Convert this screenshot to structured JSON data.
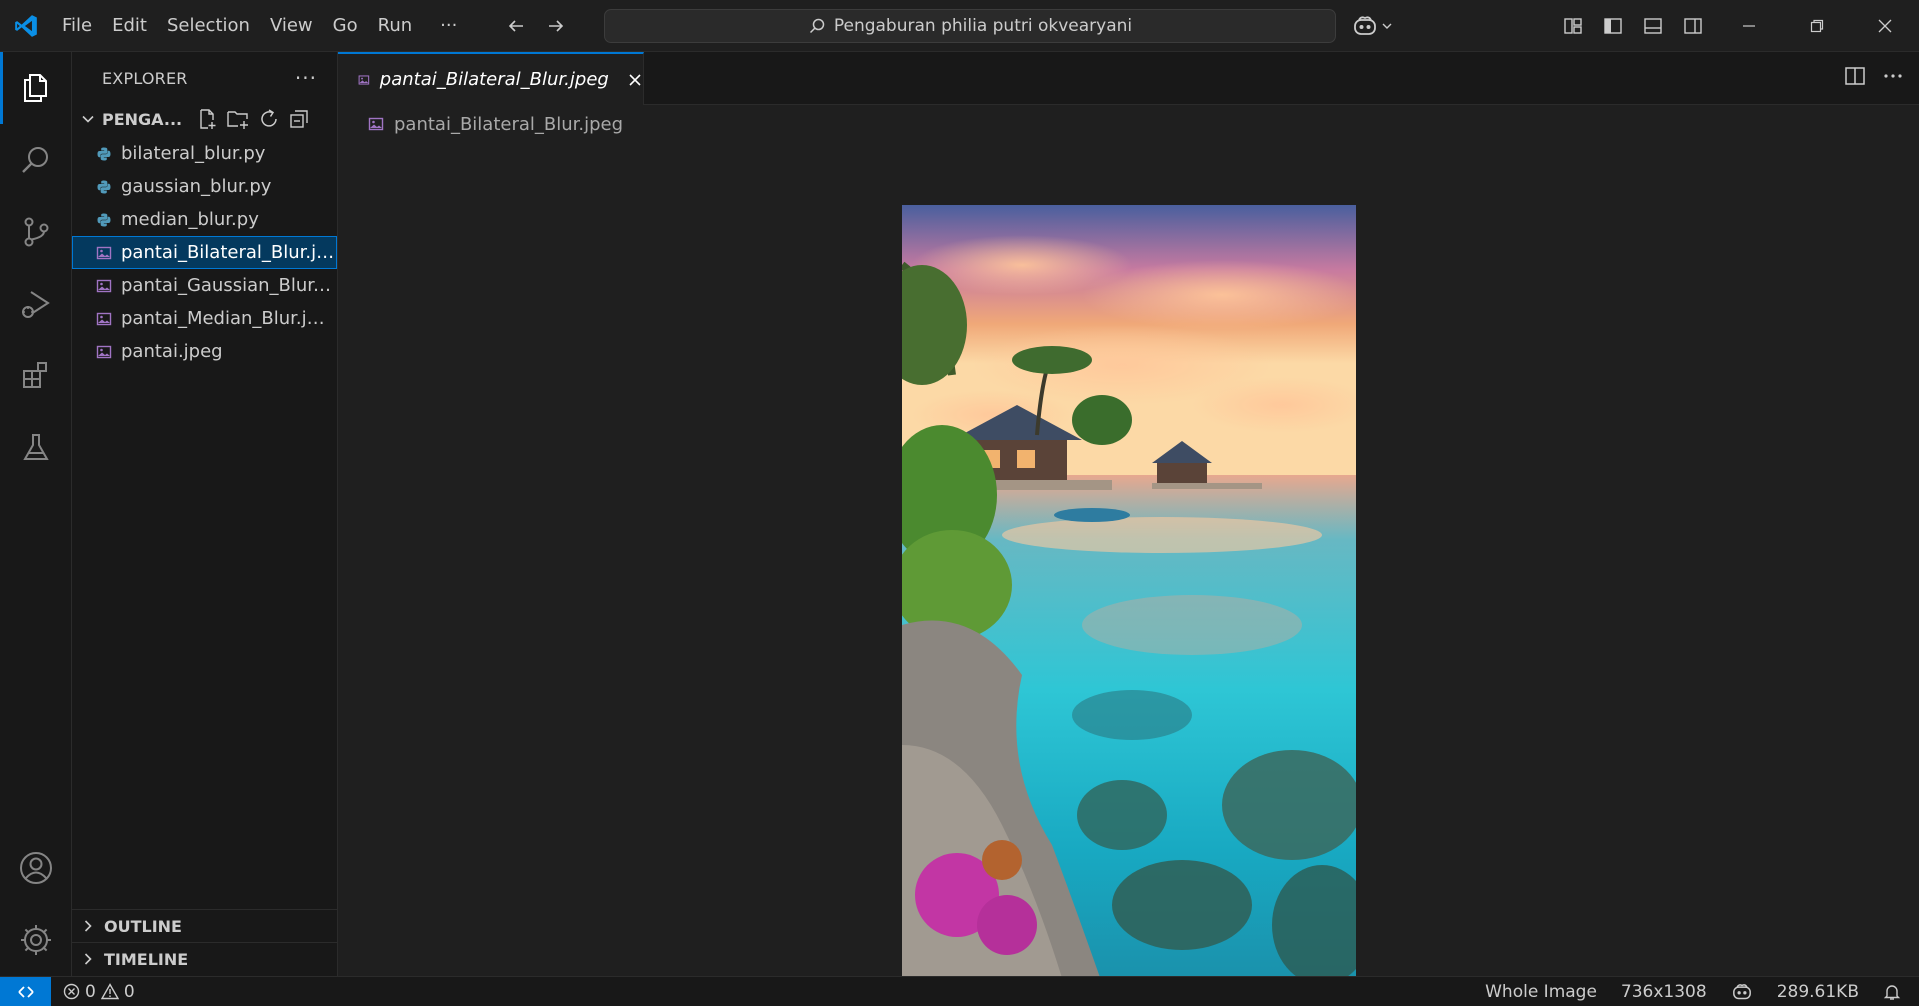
{
  "titlebar": {
    "menu": [
      "File",
      "Edit",
      "Selection",
      "View",
      "Go",
      "Run"
    ],
    "more_label": "···",
    "search_text": "Pengaburan philia putri okvearyani"
  },
  "explorer": {
    "title": "EXPLORER",
    "more_label": "···",
    "folder_name": "PENGA...",
    "files": [
      {
        "name": "bilateral_blur.py",
        "type": "python"
      },
      {
        "name": "gaussian_blur.py",
        "type": "python"
      },
      {
        "name": "median_blur.py",
        "type": "python"
      },
      {
        "name": "pantai_Bilateral_Blur.jpeg",
        "type": "image",
        "selected": true
      },
      {
        "name": "pantai_Gaussian_Blur.j...",
        "type": "image"
      },
      {
        "name": "pantai_Median_Blur.jpeg",
        "type": "image"
      },
      {
        "name": "pantai.jpeg",
        "type": "image"
      }
    ],
    "outline_label": "OUTLINE",
    "timeline_label": "TIMELINE"
  },
  "editor": {
    "tab_label": "pantai_Bilateral_Blur.jpeg",
    "breadcrumb": "pantai_Bilateral_Blur.jpeg"
  },
  "statusbar": {
    "errors": "0",
    "warnings": "0",
    "zoom": "Whole Image",
    "dimensions": "736x1308",
    "file_size": "289.61KB"
  },
  "colors": {
    "accent": "#0078d4",
    "python_icon": "#519aba",
    "image_icon": "#a074c4",
    "selected_bg": "#04395e"
  }
}
